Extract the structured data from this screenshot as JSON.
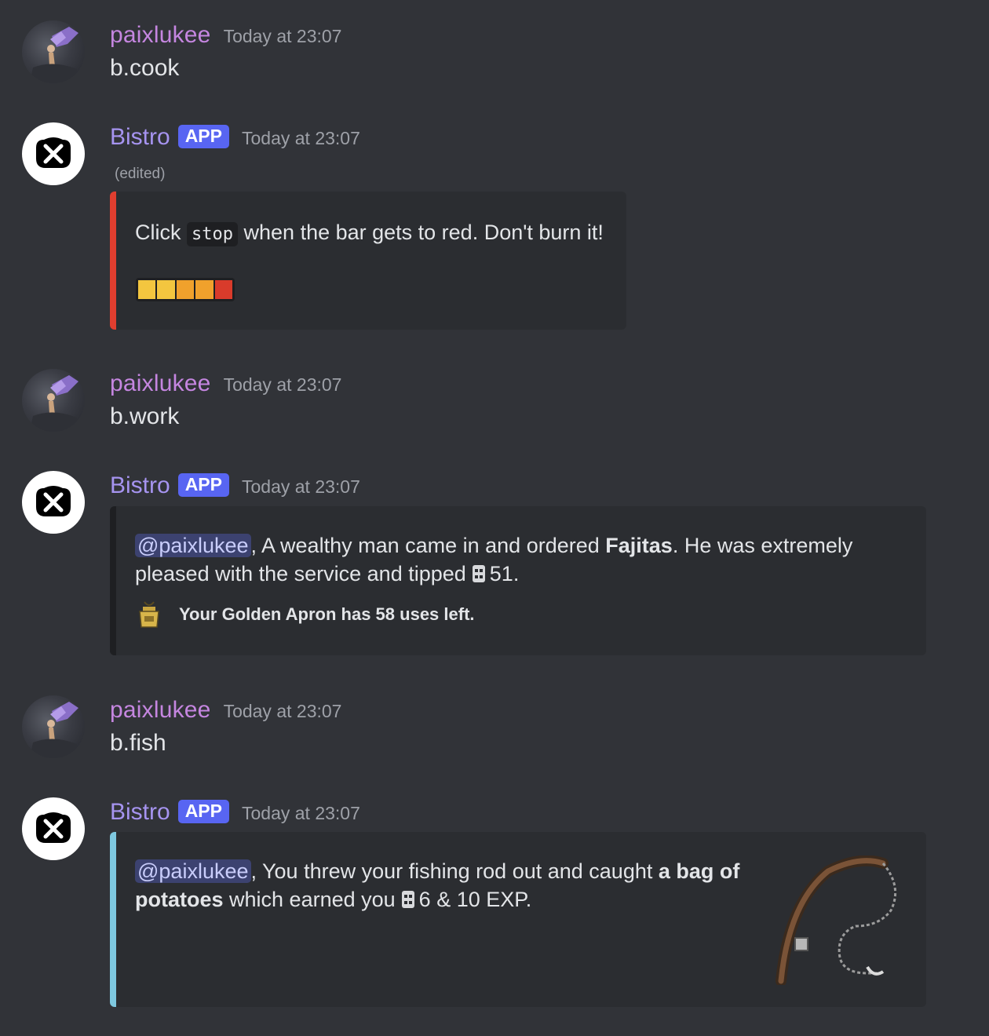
{
  "colors": {
    "background": "#313338",
    "embed_background": "#2b2d31",
    "cook_embed_bar": "#e03e2f",
    "work_embed_bar": "#1e1f22",
    "fish_embed_bar": "#7ec8df",
    "app_tag": "#5865f2",
    "username": "#c586e0",
    "botname": "#a694f0"
  },
  "messages": [
    {
      "author": "paixlukee",
      "timestamp": "Today at 23:07",
      "text": "b.cook",
      "avatar_icon": "user-avatar"
    },
    {
      "author": "Bistro",
      "tag": "APP",
      "timestamp": "Today at 23:07",
      "edited": "(edited)",
      "avatar_icon": "bistro-logo-icon",
      "embed": {
        "text_before": "Click",
        "code": "stop",
        "text_after": "when the bar gets to red. Don't burn it!",
        "progress_segments": [
          "#f3c63f",
          "#f3c63f",
          "#f0a12c",
          "#f0a12c",
          "#d93b2b"
        ]
      }
    },
    {
      "author": "paixlukee",
      "timestamp": "Today at 23:07",
      "text": "b.work",
      "avatar_icon": "user-avatar"
    },
    {
      "author": "Bistro",
      "tag": "APP",
      "timestamp": "Today at 23:07",
      "avatar_icon": "bistro-logo-icon",
      "embed": {
        "mention": "@paixlukee",
        "line1_a": ", A wealthy man came in and ordered",
        "bold": "Fajitas",
        "line1_b": ". He was extremely",
        "line2_a": "pleased with the service and tipped",
        "tip": "51.",
        "currency_icon": "coin-icon",
        "footer_icon": "golden-apron-icon",
        "footer": "Your Golden Apron has 58 uses left."
      }
    },
    {
      "author": "paixlukee",
      "timestamp": "Today at 23:07",
      "text": "b.fish",
      "avatar_icon": "user-avatar"
    },
    {
      "author": "Bistro",
      "tag": "APP",
      "timestamp": "Today at 23:07",
      "avatar_icon": "bistro-logo-icon",
      "embed": {
        "mention": "@paixlukee",
        "line1_a": ", You threw your fishing rod out and caught",
        "bold1": "a bag of",
        "bold2": "potatoes",
        "line2_a": "which earned you",
        "reward": "6 & 10 EXP.",
        "currency_icon": "coin-icon",
        "thumbnail_icon": "fishing-rod-icon"
      }
    }
  ]
}
